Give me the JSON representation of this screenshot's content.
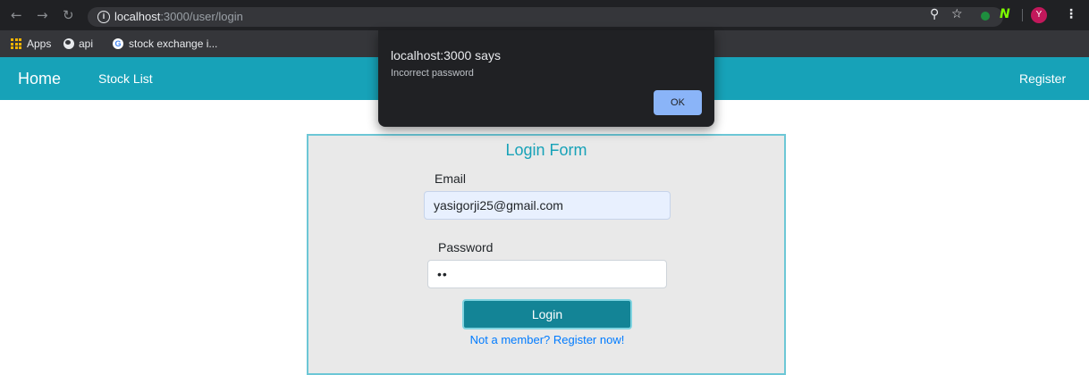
{
  "browser": {
    "url_host": "localhost",
    "url_path": ":3000/user/login",
    "profile_initial": "Y",
    "colors": {
      "profile": "#c2185b",
      "extension_green": "#1e8e3e",
      "extension_lime": "#7cfc00"
    }
  },
  "bookmarks": [
    {
      "label": "Apps",
      "icon": "apps-grid-icon"
    },
    {
      "label": "api",
      "icon": "globe-icon"
    },
    {
      "label": "stock exchange i...",
      "icon": "google-icon"
    }
  ],
  "navbar": {
    "brand": "Home",
    "links": [
      "Stock List"
    ],
    "register": "Register",
    "color": "#17a2b8"
  },
  "form": {
    "title": "Login Form",
    "email_label": "Email",
    "email_value": "yasigorji25@gmail.com",
    "password_label": "Password",
    "password_value": "••",
    "submit_label": "Login",
    "register_link": "Not a member? Register now!"
  },
  "alert": {
    "title": "localhost:3000 says",
    "message": "Incorrect password",
    "ok_label": "OK"
  }
}
